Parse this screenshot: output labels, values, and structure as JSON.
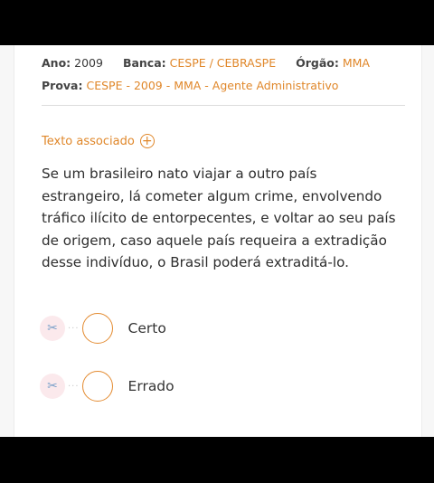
{
  "meta": {
    "ano_label": "Ano:",
    "ano_value": "2009",
    "banca_label": "Banca:",
    "banca_value": "CESPE / CEBRASPE",
    "orgao_label": "Órgão:",
    "orgao_value": "MMA",
    "prova_label": "Prova:",
    "prova_value": "CESPE - 2009 - MMA - Agente Administrativo"
  },
  "texto_associado": {
    "label": "Texto associado",
    "icon": "plus-circle-icon"
  },
  "question": {
    "statement": "Se um brasileiro nato viajar a outro país estrangeiro, lá cometer algum crime, envolvendo tráfico ilícito de entorpecentes, e voltar ao seu país de origem, caso aquele país requeira a extradição desse indivíduo, o Brasil poderá extraditá-lo."
  },
  "options": [
    {
      "label": "Certo",
      "icon": "scissors-icon"
    },
    {
      "label": "Errado",
      "icon": "scissors-icon"
    }
  ],
  "colors": {
    "accent": "#e0872a",
    "text": "#2d2d2d",
    "scissors_bg": "#fbe9ec"
  }
}
